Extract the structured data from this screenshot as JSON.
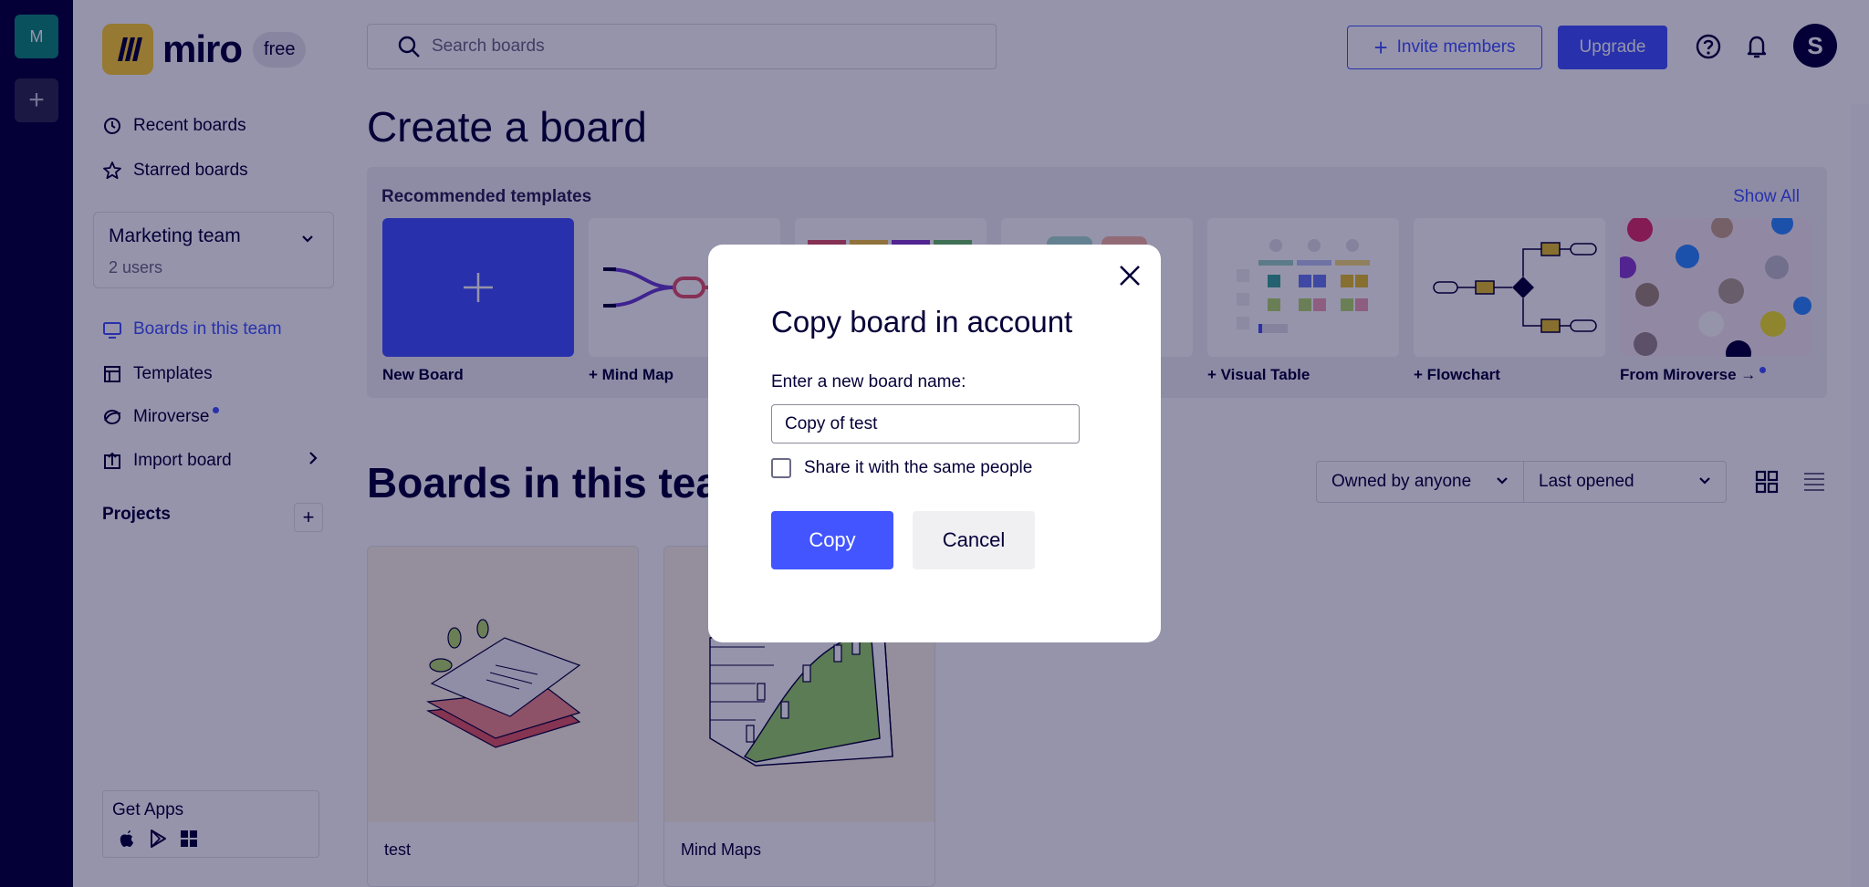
{
  "rail": {
    "workspace_initial": "M",
    "add_symbol": "+"
  },
  "sidebar": {
    "brand": "miro",
    "plan": "free",
    "nav": [
      {
        "label": "Recent boards",
        "icon": "clock-icon"
      },
      {
        "label": "Starred boards",
        "icon": "star-icon"
      }
    ],
    "team": {
      "name": "Marketing team",
      "users": "2 users"
    },
    "team_nav": [
      {
        "label": "Boards in this team",
        "icon": "board-icon",
        "active": true
      },
      {
        "label": "Templates",
        "icon": "template-icon"
      },
      {
        "label": "Miroverse",
        "icon": "miroverse-icon"
      },
      {
        "label": "Import board",
        "icon": "import-icon"
      }
    ],
    "projects_label": "Projects",
    "get_apps": "Get Apps"
  },
  "header": {
    "search_placeholder": "Search boards",
    "invite_label": "Invite members",
    "upgrade_label": "Upgrade",
    "avatar_initial": "S"
  },
  "create": {
    "title": "Create a board",
    "recommended_label": "Recommended templates",
    "show_all": "Show All",
    "templates": [
      {
        "label": "New Board"
      },
      {
        "label": "+ Mind Map"
      },
      {
        "label": ""
      },
      {
        "label": ""
      },
      {
        "label": "+ Visual Table"
      },
      {
        "label": "+ Flowchart"
      },
      {
        "label": "From Miroverse →"
      }
    ]
  },
  "boards": {
    "title": "Boards in this team",
    "owner_filter": "Owned by anyone",
    "sort_filter": "Last opened",
    "items": [
      {
        "name": "test"
      },
      {
        "name": "Mind Maps"
      }
    ]
  },
  "modal": {
    "title": "Copy board in account",
    "field_label": "Enter a new board name:",
    "field_value": "Copy of test",
    "share_label": "Share it with the same people",
    "share_checked": false,
    "copy_label": "Copy",
    "cancel_label": "Cancel"
  },
  "colors": {
    "accent": "#4255ff",
    "ink": "#050038",
    "brand_yellow": "#ffd02f",
    "rail": "#050038",
    "workspace_badge": "#0f8c7a"
  }
}
